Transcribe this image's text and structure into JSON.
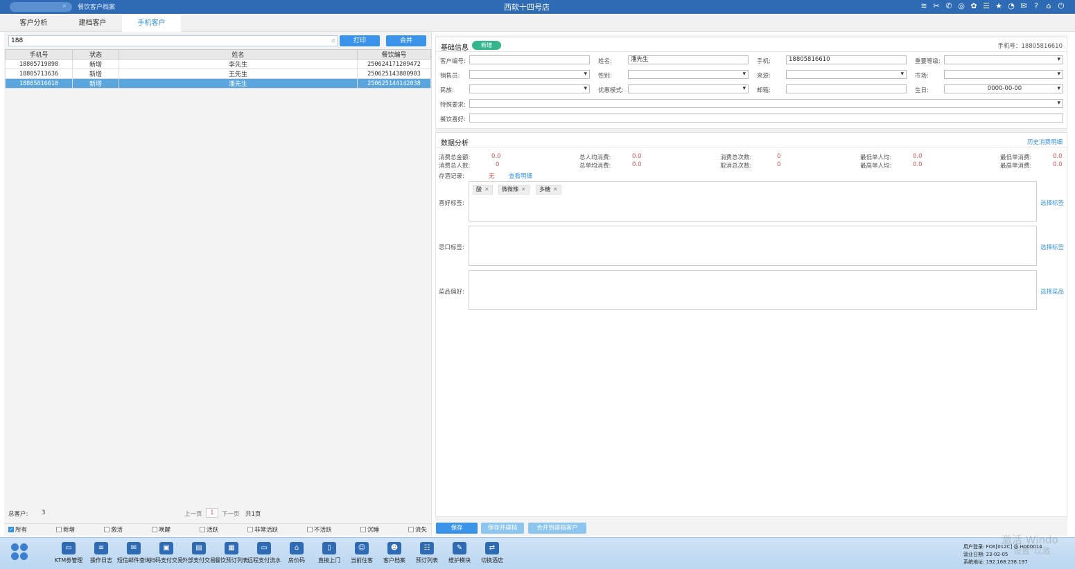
{
  "titlebar": {
    "app_name": "餐饮客户档案",
    "store": "西软十四号店",
    "icons": [
      "wifi-icon",
      "tools-icon",
      "phone-icon",
      "search-person-icon",
      "palette-icon",
      "menu-icon",
      "star-icon",
      "clock-icon",
      "mail-icon",
      "help-icon",
      "home-icon",
      "power-icon"
    ]
  },
  "tabs": [
    "客户分析",
    "建档客户",
    "手机客户"
  ],
  "left": {
    "search_value": "188",
    "print_label": "打印",
    "merge_label": "合并",
    "columns": [
      "手机号",
      "状态",
      "姓名",
      "餐饮编号"
    ],
    "rows": [
      [
        "18805719898",
        "新增",
        "李先生",
        "250624171209472"
      ],
      [
        "18805713636",
        "新增",
        "王先生",
        "250625143800903"
      ],
      [
        "18805816610",
        "新增",
        "潘先生",
        "250625144142038"
      ]
    ],
    "total_label": "总客户:",
    "total_value": "3",
    "prev_label": "上一页",
    "page_num": "1",
    "next_label": "下一页",
    "pages_label": "共1页",
    "filters": [
      "所有",
      "新增",
      "激活",
      "唤醒",
      "活跃",
      "非常活跃",
      "不活跃",
      "沉睡",
      "流失"
    ]
  },
  "basic": {
    "title": "基础信息",
    "badge": "新增",
    "phone_header": "手机号：18805816610",
    "labels": {
      "cust_no": "客户编号:",
      "name": "姓名:",
      "mobile": "手机:",
      "importance": "重要等级:",
      "sales": "销售员:",
      "gender": "性别:",
      "source": "来源:",
      "market": "市场:",
      "nation": "民族:",
      "discount": "优惠模式:",
      "email": "邮箱:",
      "birthday": "生日:",
      "special": "特殊要求:",
      "hobby": "餐饮喜好:"
    },
    "values": {
      "name": "潘先生",
      "mobile": "18805816610",
      "birthday": "0000-00-00"
    }
  },
  "analysis": {
    "title": "数据分析",
    "history_link": "历史消费明细",
    "stats": [
      {
        "label": "消费总金额:",
        "value": "0.0"
      },
      {
        "label": "消费总人数:",
        "value": "0"
      },
      {
        "label": "总人均消费:",
        "value": "0.0"
      },
      {
        "label": "总单均消费:",
        "value": "0.0"
      },
      {
        "label": "消费总次数:",
        "value": "0"
      },
      {
        "label": "取消总次数:",
        "value": "0"
      },
      {
        "label": "最低单人均:",
        "value": "0.0"
      },
      {
        "label": "最高单人均:",
        "value": "0.0"
      },
      {
        "label": "最低单消费:",
        "value": "0.0"
      },
      {
        "label": "最高单消费:",
        "value": "0.0"
      }
    ],
    "wine_label": "存酒记录:",
    "wine_value": "无",
    "wine_link": "查看明细",
    "like_label": "喜好标签:",
    "like_tags": [
      "酸",
      "微微辣",
      "多糖"
    ],
    "like_link": "选择标签",
    "avoid_label": "忌口标签:",
    "avoid_link": "选择标签",
    "dish_label": "菜品偏好:",
    "dish_link": "选择菜品"
  },
  "actions": [
    "保存",
    "保存并建档",
    "合并到建档客户"
  ],
  "taskbar": [
    {
      "label": "KTM劵管理",
      "icon": "ticket-icon"
    },
    {
      "label": "操作日志",
      "icon": "log-icon"
    },
    {
      "label": "短信邮件查询",
      "icon": "mail-icon"
    },
    {
      "label": "扫码支付交易",
      "icon": "scan-icon"
    },
    {
      "label": "外部支付交易",
      "icon": "pay-icon"
    },
    {
      "label": "餐饮预订列表",
      "icon": "booking-icon"
    },
    {
      "label": "远程支付流水",
      "icon": "remote-pay-icon"
    },
    {
      "label": "房价码",
      "icon": "house-icon"
    },
    {
      "label": "直接上门",
      "icon": "door-icon"
    },
    {
      "label": "当前住客",
      "icon": "guest-icon"
    },
    {
      "label": "客户档案",
      "icon": "profile-icon"
    },
    {
      "label": "预订列表",
      "icon": "list-icon"
    },
    {
      "label": "维护模块",
      "icon": "wrench-icon"
    },
    {
      "label": "切换酒店",
      "icon": "switch-icon"
    }
  ],
  "sysinfo": {
    "user": "用户登录:   FOX[012C] @ H000014",
    "date": "营业日期:   23-02-05",
    "addr": "系统地址:   192.168.238.197"
  },
  "watermark": {
    "line1": "激活 Windo",
    "line2": "设置\"以激"
  }
}
